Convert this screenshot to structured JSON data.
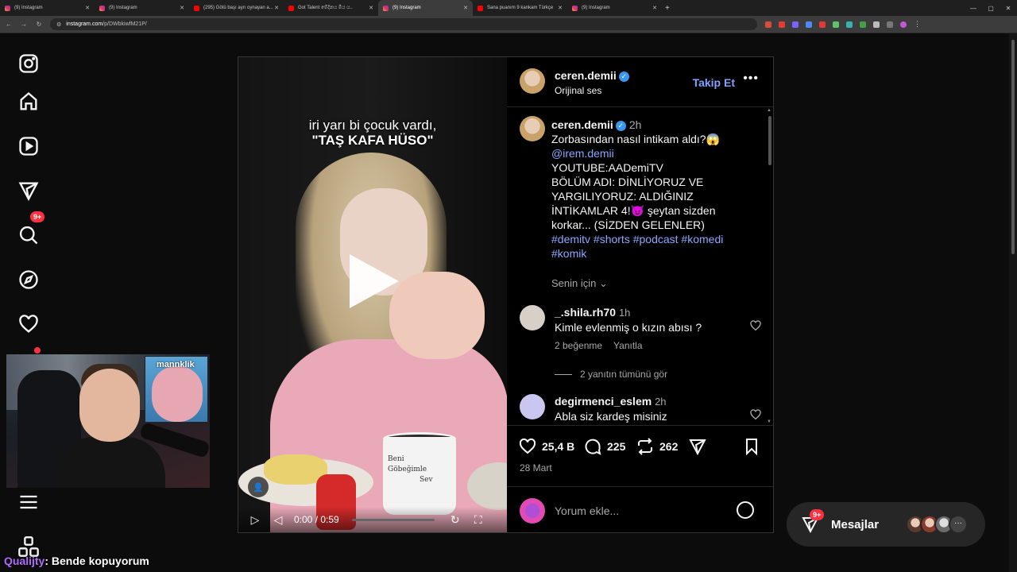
{
  "browser": {
    "tabs": [
      {
        "label": "(9) Instagram",
        "favicon": "instagram-icon",
        "active": false
      },
      {
        "label": "(9) Instagram",
        "favicon": "instagram-icon",
        "active": false
      },
      {
        "label": "(295) Götü başı ayrı oynayan a...",
        "favicon": "youtube-icon",
        "active": false
      },
      {
        "label": "Got Talent මේදිනය මිය ය..",
        "favicon": "youtube-icon",
        "active": false
      },
      {
        "label": "(9) Instagram",
        "favicon": "instagram-icon",
        "active": true
      },
      {
        "label": "Sana puanım 9 kankam Türkçe",
        "favicon": "youtube-icon",
        "active": false
      },
      {
        "label": "(9) Instagram",
        "favicon": "instagram-icon",
        "active": false
      }
    ],
    "url_host": "instagram.com",
    "url_path": "/p/DWbkiwfM21P/"
  },
  "nav": {
    "notification_badge": "9+"
  },
  "stream": {
    "pip_text": "mannklik",
    "chat_user": "Qualijty",
    "chat_message": ": Bende kopuyorum"
  },
  "video": {
    "caption_line1": "iri yarı bi çocuk vardı,",
    "caption_line2": "\"TAŞ KAFA HÜSO\"",
    "mug_text_1": "Beni",
    "mug_text_2": "Göbeğimle",
    "mug_text_3": "Sev",
    "time": "0:00 / 0:59"
  },
  "post": {
    "author": "ceren.demii",
    "audio": "Orijinal ses",
    "follow_label": "Takip Et",
    "caption_time": "2h",
    "caption_line1": "Zorbasından nasıl intikam aldı?😱",
    "caption_mention": "@irem.demii",
    "caption_line3": "YOUTUBE:AADemiTV",
    "caption_line4": "BÖLÜM ADI: DİNLİYORUZ VE YARGILIYORUZ: ALDIĞINIZ İNTİKAMLAR 4!😈 şeytan sizden korkar... (SİZDEN GELENLER)",
    "caption_hashtags": "#demitv #shorts #podcast #komedi #komik",
    "for_you": "Senin için",
    "comments": [
      {
        "user": "_.shila.rh70",
        "time": "1h",
        "text": "Kimle evlenmiş o kızın abısı ?",
        "likes": "2 beğenme",
        "reply": "Yanıtla"
      },
      {
        "user": "degirmenci_eslem",
        "time": "2h",
        "text": "Abla siz kardeş misiniz",
        "likes": "",
        "reply": ""
      }
    ],
    "view_replies": "2 yanıtın tümünü gör",
    "like_count": "25,4 B",
    "comment_count": "225",
    "repost_count": "262",
    "date": "28 Mart",
    "add_comment_placeholder": "Yorum ekle..."
  },
  "messages": {
    "label": "Mesajlar",
    "badge": "9+"
  },
  "colors": {
    "accent_link": "#85a1ff",
    "badge_red": "#ff3040",
    "verified_blue": "#3897f0"
  }
}
